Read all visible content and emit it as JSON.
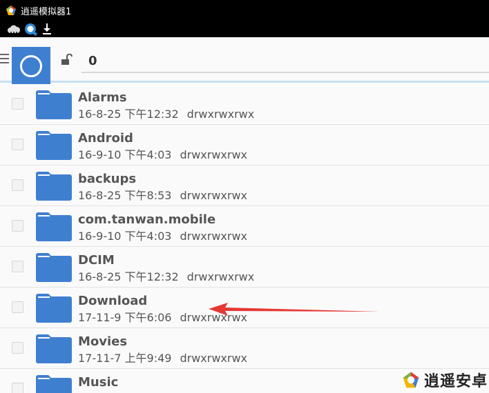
{
  "window": {
    "title": "逍遥模拟器1"
  },
  "statusbar": {
    "icons": [
      "cloud-icon",
      "q-app-icon",
      "download-icon"
    ]
  },
  "header": {
    "path": "0"
  },
  "files": [
    {
      "name": "Alarms",
      "date": "16-8-25 下午12:32",
      "perm": "drwxrwxrwx"
    },
    {
      "name": "Android",
      "date": "16-9-10 下午4:03",
      "perm": "drwxrwxrwx"
    },
    {
      "name": "backups",
      "date": "16-8-25 下午8:53",
      "perm": "drwxrwxrwx"
    },
    {
      "name": "com.tanwan.mobile",
      "date": "16-9-10 下午4:03",
      "perm": "drwxrwxrwx"
    },
    {
      "name": "DCIM",
      "date": "16-8-25 下午12:32",
      "perm": "drwxrwxrwx"
    },
    {
      "name": "Download",
      "date": "17-11-9 下午6:06",
      "perm": "drwxrwxrwx"
    },
    {
      "name": "Movies",
      "date": "17-11-7 上午9:49",
      "perm": "drwxrwxrwx"
    },
    {
      "name": "Music",
      "date": "",
      "perm": ""
    }
  ],
  "annotation": {
    "color": "#e53935",
    "points_to": "Download"
  },
  "watermark": {
    "text": "逍遥安卓"
  },
  "colors": {
    "folder": "#3f7fd0",
    "header_underline": "#c7dff2"
  }
}
